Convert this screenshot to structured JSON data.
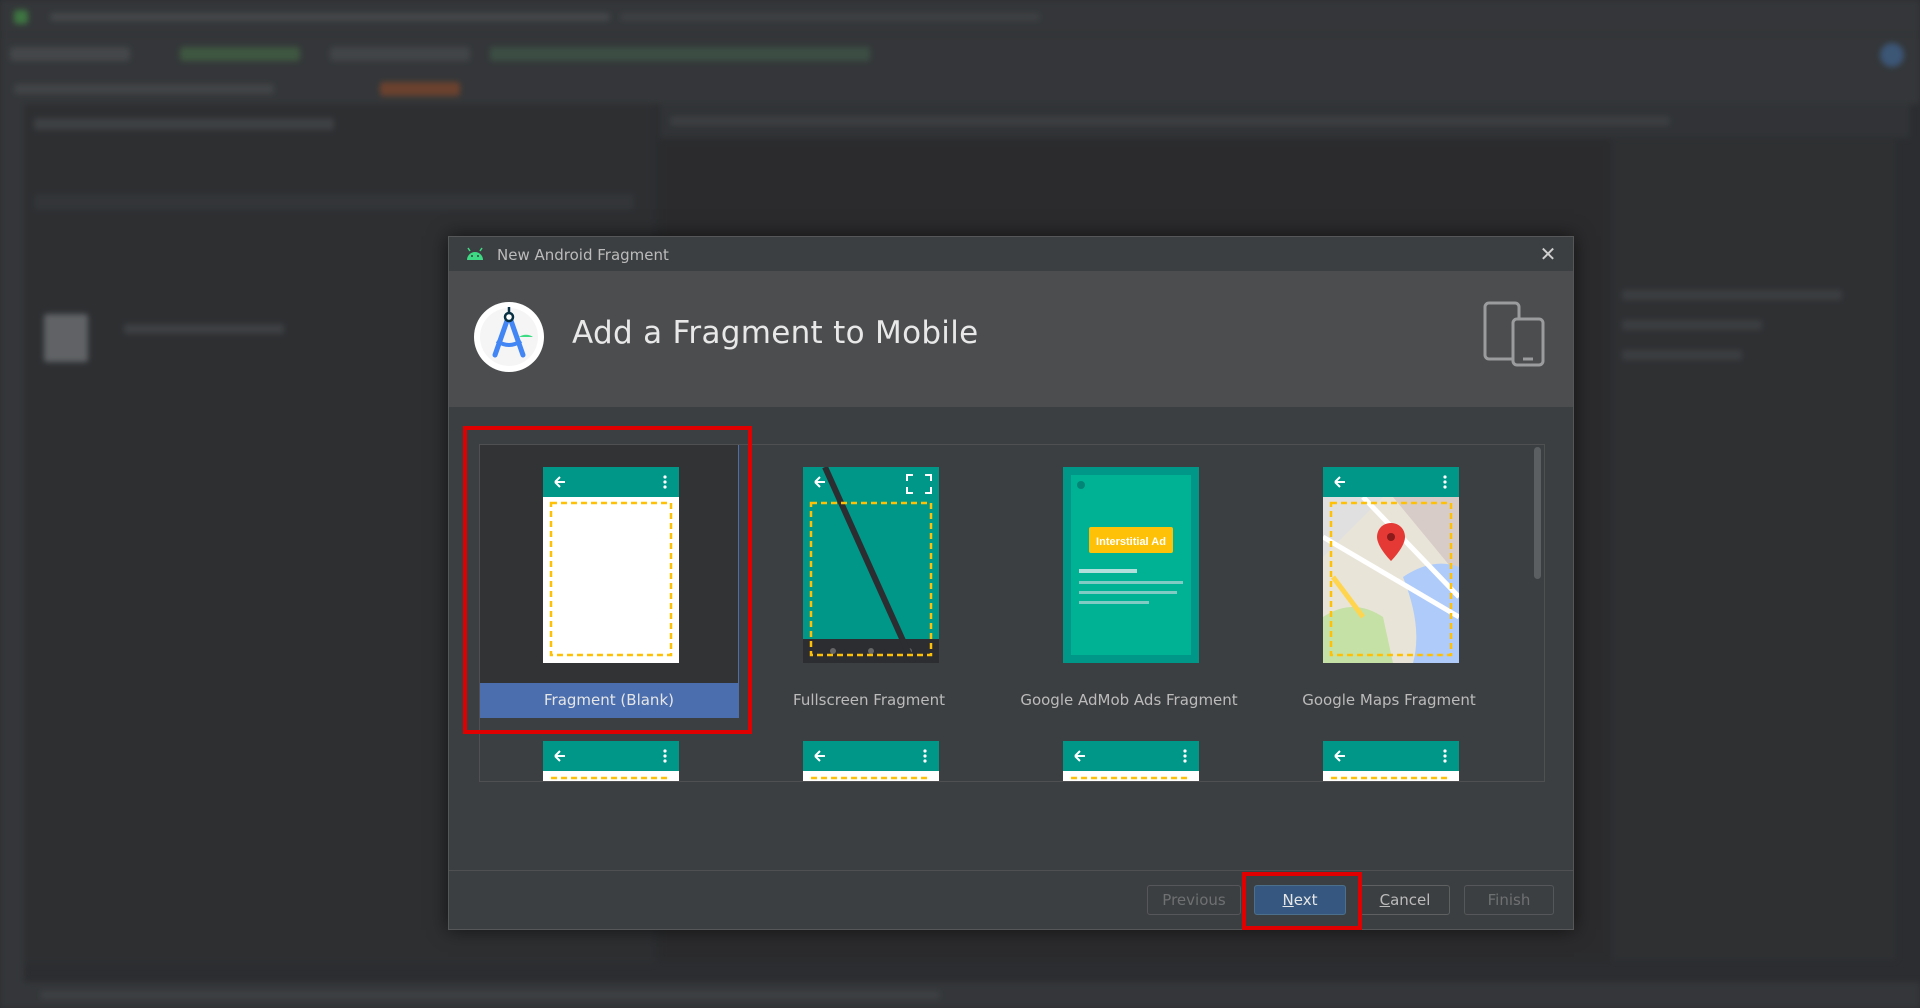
{
  "dialog": {
    "title": "New Android Fragment",
    "header_title": "Add a Fragment to Mobile",
    "close_glyph": "✕"
  },
  "templates": [
    {
      "label": "Fragment (Blank)",
      "icon": "blank-fragment-preview",
      "selected": true
    },
    {
      "label": "Fullscreen Fragment",
      "icon": "fullscreen-fragment-preview",
      "selected": false
    },
    {
      "label": "Google AdMob Ads Fragment",
      "icon": "admob-fragment-preview",
      "selected": false,
      "badge": "Interstitial Ad"
    },
    {
      "label": "Google Maps Fragment",
      "icon": "maps-fragment-preview",
      "selected": false
    }
  ],
  "buttons": {
    "previous": "Previous",
    "next_mnemonic": "N",
    "next_rest": "ext",
    "cancel_mnemonic": "C",
    "cancel_rest": "ancel",
    "finish": "Finish"
  },
  "colors": {
    "teal": "#009688",
    "accent_yellow": "#ffc107",
    "selection_blue": "#4b6eaf",
    "highlight_red": "#e00000",
    "default_button": "#365880"
  }
}
